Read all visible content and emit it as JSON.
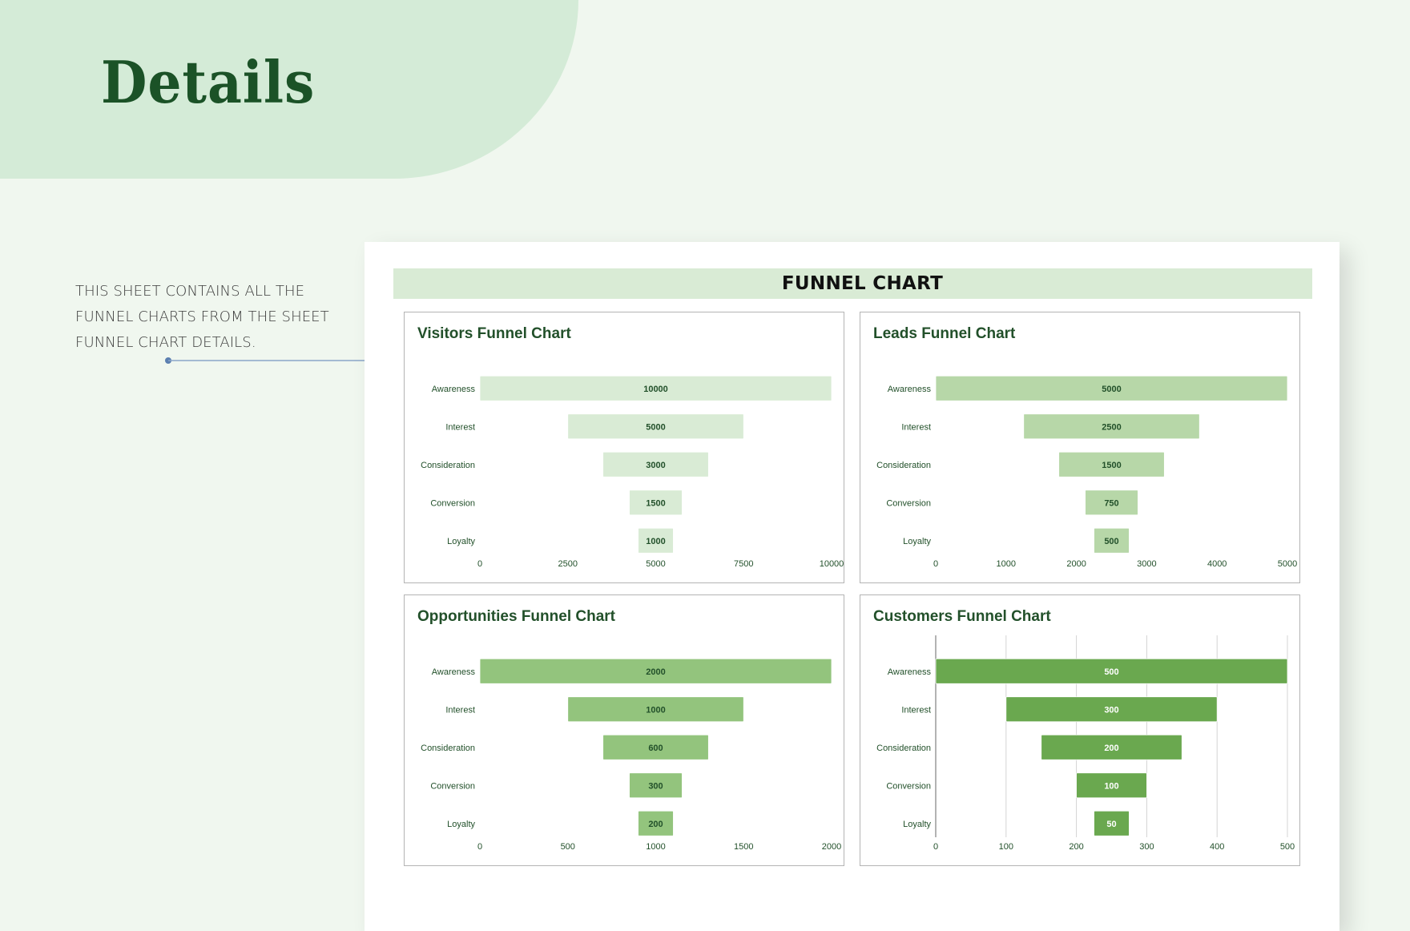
{
  "page": {
    "title": "Details",
    "description": "THIS SHEET CONTAINS ALL THE FUNNEL CHARTS FROM THE SHEET FUNNEL CHART DETAILS.",
    "header": "FUNNEL CHART"
  },
  "colors": {
    "title": "#1b5227",
    "hero_bg": "#d4ebd7",
    "page_bg": "#f0f7ef",
    "header_bg": "#d9ebd5",
    "label_text": "#22502a",
    "pointer": "#5b7fb0"
  },
  "chart_data": [
    {
      "type": "bar",
      "subtype": "funnel",
      "title": "Visitors Funnel Chart",
      "categories": [
        "Awareness",
        "Interest",
        "Consideration",
        "Conversion",
        "Loyalty"
      ],
      "values": [
        10000,
        5000,
        3000,
        1500,
        1000
      ],
      "xlim": [
        0,
        10000
      ],
      "xticks": [
        "0",
        "2500",
        "5000",
        "7500",
        "10000"
      ],
      "bar_color": "#d9ebd5",
      "value_label_color": "#22502a",
      "grid": false,
      "legend": "none"
    },
    {
      "type": "bar",
      "subtype": "funnel",
      "title": "Leads Funnel Chart",
      "categories": [
        "Awareness",
        "Interest",
        "Consideration",
        "Conversion",
        "Loyalty"
      ],
      "values": [
        5000,
        2500,
        1500,
        750,
        500
      ],
      "xlim": [
        0,
        5000
      ],
      "xticks": [
        "0",
        "1000",
        "2000",
        "3000",
        "4000",
        "5000"
      ],
      "bar_color": "#b7d7a8",
      "value_label_color": "#22502a",
      "grid": false,
      "legend": "none"
    },
    {
      "type": "bar",
      "subtype": "funnel",
      "title": "Opportunities Funnel Chart",
      "categories": [
        "Awareness",
        "Interest",
        "Consideration",
        "Conversion",
        "Loyalty"
      ],
      "values": [
        2000,
        1000,
        600,
        300,
        200
      ],
      "xlim": [
        0,
        2000
      ],
      "xticks": [
        "0",
        "500",
        "1000",
        "1500",
        "2000"
      ],
      "bar_color": "#93c47d",
      "value_label_color": "#22502a",
      "grid": false,
      "legend": "none"
    },
    {
      "type": "bar",
      "subtype": "funnel",
      "title": "Customers Funnel Chart",
      "categories": [
        "Awareness",
        "Interest",
        "Consideration",
        "Conversion",
        "Loyalty"
      ],
      "values": [
        500,
        300,
        200,
        100,
        50
      ],
      "xlim": [
        0,
        500
      ],
      "xticks": [
        "0",
        "100",
        "200",
        "300",
        "400",
        "500"
      ],
      "bar_color": "#6aa84f",
      "value_label_color": "#ffffff",
      "grid": true,
      "legend": "none"
    }
  ]
}
